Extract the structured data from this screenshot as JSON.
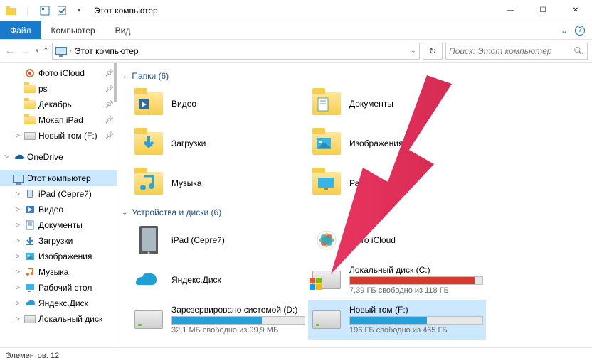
{
  "window": {
    "title": "Этот компьютер",
    "min": "—",
    "max": "☐",
    "close": "✕"
  },
  "ribbon": {
    "file": "Файл",
    "tabs": [
      "Компьютер",
      "Вид"
    ]
  },
  "address": {
    "path_label": "Этот компьютер",
    "search_placeholder": "Поиск: Этот компьютер"
  },
  "sidebar": [
    {
      "icon": "photos",
      "label": "Фото iCloud",
      "indent": 1,
      "pin": true
    },
    {
      "icon": "folder",
      "label": "ps",
      "indent": 1,
      "pin": true
    },
    {
      "icon": "folder",
      "label": "Декабрь",
      "indent": 1,
      "pin": true
    },
    {
      "icon": "folder",
      "label": "Мокап iPad",
      "indent": 1,
      "pin": true
    },
    {
      "icon": "drive",
      "label": "Новый том (F:)",
      "indent": 1,
      "pin": true,
      "expand": ">"
    },
    {
      "icon": "onedrive",
      "label": "OneDrive",
      "indent": 0,
      "gapTop": true,
      "expand": ">"
    },
    {
      "icon": "thispc",
      "label": "Этот компьютер",
      "indent": 0,
      "selected": true,
      "gapTop": true
    },
    {
      "icon": "ipad",
      "label": "iPad (Сергей)",
      "indent": 1,
      "expand": ">"
    },
    {
      "icon": "video",
      "label": "Видео",
      "indent": 1,
      "expand": ">"
    },
    {
      "icon": "docs",
      "label": "Документы",
      "indent": 1,
      "expand": ">"
    },
    {
      "icon": "downloads",
      "label": "Загрузки",
      "indent": 1,
      "expand": ">"
    },
    {
      "icon": "pictures",
      "label": "Изображения",
      "indent": 1,
      "expand": ">"
    },
    {
      "icon": "music",
      "label": "Музыка",
      "indent": 1,
      "expand": ">"
    },
    {
      "icon": "desktop",
      "label": "Рабочий стол",
      "indent": 1,
      "expand": ">"
    },
    {
      "icon": "yadisk",
      "label": "Яндекс.Диск",
      "indent": 1,
      "expand": ">"
    },
    {
      "icon": "drive",
      "label": "Локальный диск",
      "indent": 1,
      "expand": ">"
    }
  ],
  "groups": {
    "folders": {
      "header": "Папки (6)",
      "items": [
        {
          "icon": "video",
          "label": "Видео"
        },
        {
          "icon": "docs",
          "label": "Документы"
        },
        {
          "icon": "downloads",
          "label": "Загрузки"
        },
        {
          "icon": "pictures",
          "label": "Изображения"
        },
        {
          "icon": "music",
          "label": "Музыка"
        },
        {
          "icon": "desktop",
          "label": "Рабочий стол"
        }
      ]
    },
    "drives": {
      "header": "Устройства и диски (6)",
      "items": [
        {
          "icon": "ipad-dev",
          "label": "iPad (Сергей)"
        },
        {
          "icon": "photos",
          "label": "Фото iCloud"
        },
        {
          "icon": "yadisk",
          "label": "Яндекс.Диск"
        },
        {
          "icon": "drive-c",
          "label": "Локальный диск (C:)",
          "sub": "7,39 ГБ свободно из 118 ГБ",
          "fill": 94,
          "color": "#d63a2d"
        },
        {
          "icon": "drive",
          "label": "Зарезервировано системой (D:)",
          "sub": "32,1 МБ свободно из 99,9 МБ",
          "fill": 68,
          "color": "#26a0da"
        },
        {
          "icon": "drive",
          "label": "Новый том (F:)",
          "sub": "196 ГБ свободно из 465 ГБ",
          "fill": 58,
          "color": "#26a0da",
          "selected": true
        }
      ]
    }
  },
  "status": {
    "text": "Элементов: 12"
  }
}
